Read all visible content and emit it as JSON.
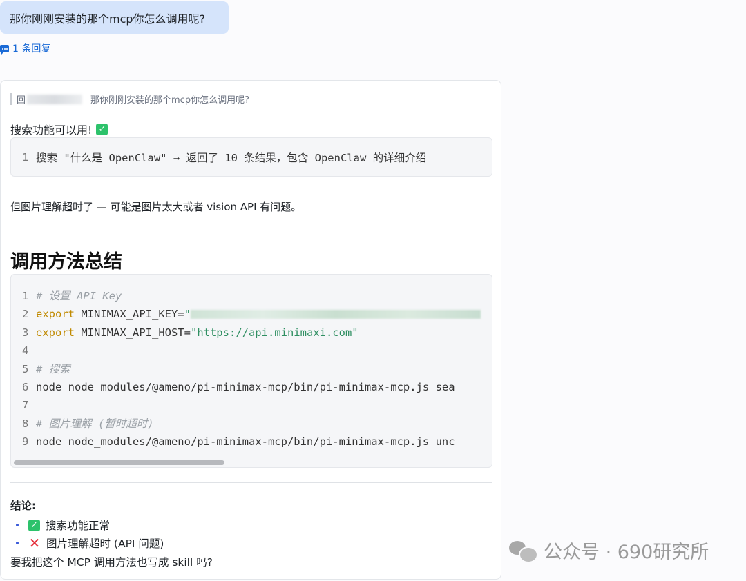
{
  "user_message": {
    "text": "那你刚刚安装的那个mcp你怎么调用呢?"
  },
  "reply_link": {
    "label": "1 条回复"
  },
  "card": {
    "quote": {
      "prefix": "回",
      "text": "那你刚刚安装的那个mcp你怎么调用呢?"
    },
    "status_line": "搜索功能可以用!",
    "code_block_1": {
      "lines": [
        {
          "num": "1",
          "text": "搜索 \"什么是 OpenClaw\" → 返回了 10 条结果，包含 OpenClaw 的详细介绍"
        }
      ]
    },
    "paragraph": "但图片理解超时了 — 可能是图片太大或者 vision API 有问题。",
    "heading": "调用方法总结",
    "code_block_2": {
      "lines": [
        {
          "num": "1",
          "comment": "# 设置 API Key"
        },
        {
          "num": "2",
          "keyword": "export",
          "text": " MINIMAX_API_KEY=",
          "string": "\""
        },
        {
          "num": "3",
          "keyword": "export",
          "text": " MINIMAX_API_HOST=",
          "string": "\"https://api.minimaxi.com\""
        },
        {
          "num": "4"
        },
        {
          "num": "5",
          "comment": "# 搜索"
        },
        {
          "num": "6",
          "text": "node node_modules/@ameno/pi-minimax-mcp/bin/pi-minimax-mcp.js sea"
        },
        {
          "num": "7"
        },
        {
          "num": "8",
          "comment": "# 图片理解 (暂时超时)"
        },
        {
          "num": "9",
          "text": "node node_modules/@ameno/pi-minimax-mcp/bin/pi-minimax-mcp.js unc"
        }
      ]
    },
    "conclusion_label": "结论:",
    "bullets": [
      {
        "icon": "check-icon",
        "text": "搜索功能正常"
      },
      {
        "icon": "cross-icon",
        "text": "图片理解超时 (API 问题)"
      }
    ],
    "final_question": "要我把这个 MCP 调用方法也写成 skill 吗?"
  },
  "watermark": {
    "text": "公众号 · 690研究所"
  },
  "colors": {
    "accent": "#1a6ad6",
    "bubble": "#d5e4fb",
    "check": "#2dc26b",
    "cross": "#e5323e"
  }
}
